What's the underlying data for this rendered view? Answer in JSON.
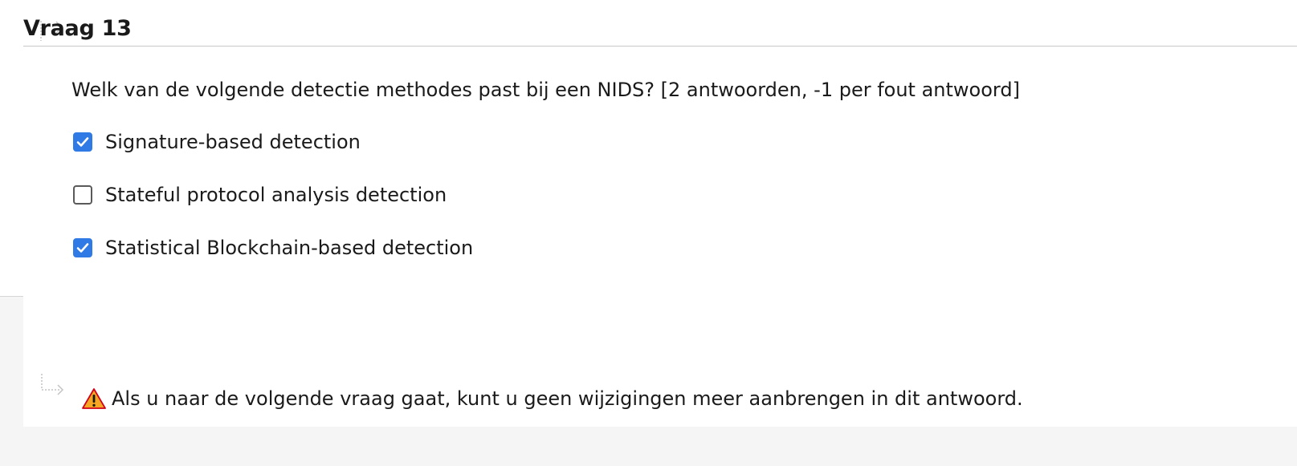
{
  "question": {
    "title": "Vraag 13",
    "text": "Welk van de volgende detectie methodes past bij een NIDS? [2 antwoorden, -1 per fout antwoord]",
    "options": [
      {
        "label": "Signature-based detection",
        "checked": true
      },
      {
        "label": "Stateful protocol analysis detection",
        "checked": false
      },
      {
        "label": "Statistical Blockchain-based detection",
        "checked": true
      }
    ]
  },
  "footer": {
    "warning_icon": "warning-icon",
    "warning_text": "Als u naar de volgende vraag gaat, kunt u geen wijzigingen meer aanbrengen in dit antwoord."
  },
  "colors": {
    "accent": "#2f7ae5",
    "warning": "#f5a623",
    "panel": "#ffffff",
    "background": "#f5f5f5"
  }
}
